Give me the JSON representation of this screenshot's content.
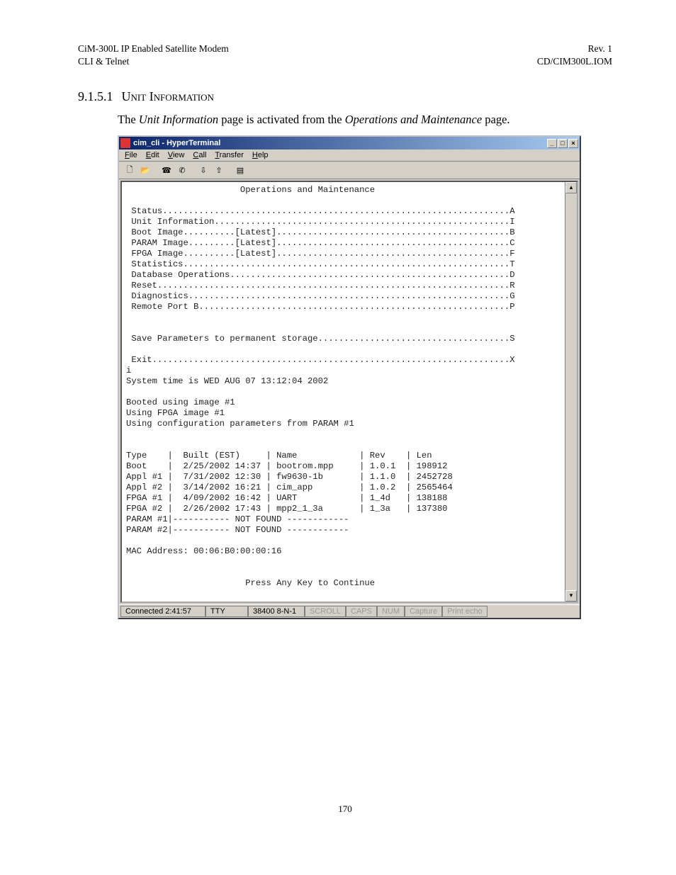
{
  "header": {
    "left1": "CiM-300L IP Enabled Satellite Modem",
    "left2": "CLI & Telnet",
    "right1": "Rev. 1",
    "right2": "CD/CIM300L.IOM"
  },
  "section": {
    "number": "9.1.5.1",
    "title_caps": "Unit Information",
    "intro_prefix": "The ",
    "intro_em1": "Unit Information",
    "intro_mid": " page is activated from the ",
    "intro_em2": "Operations and Maintenance",
    "intro_suffix": " page."
  },
  "win": {
    "title": "cim_cli - HyperTerminal",
    "menu": {
      "file": "File",
      "edit": "Edit",
      "view": "View",
      "call": "Call",
      "transfer": "Transfer",
      "help": "Help"
    },
    "controls": {
      "min": "_",
      "max": "□",
      "close": "×"
    },
    "toolbar_icons": [
      "new-doc-icon",
      "open-icon",
      "call-connect-icon",
      "call-disconnect-icon",
      "send-icon",
      "receive-icon",
      "properties-icon"
    ]
  },
  "term": {
    "heading": "                      Operations and Maintenance",
    "lines": [
      " Status...................................................................A",
      " Unit Information.........................................................I",
      " Boot Image..........[Latest].............................................B",
      " PARAM Image.........[Latest].............................................C",
      " FPGA Image..........[Latest].............................................F",
      " Statistics...............................................................T",
      " Database Operations......................................................D",
      " Reset....................................................................R",
      " Diagnostics..............................................................G",
      " Remote Port B............................................................P",
      "",
      "",
      " Save Parameters to permanent storage.....................................S",
      "",
      " Exit.....................................................................X",
      "i",
      "System time is WED AUG 07 13:12:04 2002",
      "",
      "Booted using image #1",
      "Using FPGA image #1",
      "Using configuration parameters from PARAM #1",
      "",
      "",
      "Type    |  Built (EST)     | Name            | Rev    | Len",
      "Boot    |  2/25/2002 14:37 | bootrom.mpp     | 1.0.1  | 198912",
      "Appl #1 |  7/31/2002 12:30 | fw9630-1b       | 1.1.0  | 2452728",
      "Appl #2 |  3/14/2002 16:21 | cim_app         | 1.0.2  | 2565464",
      "FPGA #1 |  4/09/2002 16:42 | UART            | 1_4d   | 138188",
      "FPGA #2 |  2/26/2002 17:43 | mpp2_1_3a       | 1_3a   | 137380",
      "PARAM #1|----------- NOT FOUND ------------",
      "PARAM #2|----------- NOT FOUND ------------",
      "",
      "MAC Address: 00:06:B0:00:00:16",
      "",
      "",
      "                       Press Any Key to Continue"
    ]
  },
  "statusbar": {
    "connected": "Connected 2:41:57",
    "emu": "TTY",
    "rate": "38400 8-N-1",
    "cells": [
      "SCROLL",
      "CAPS",
      "NUM",
      "Capture",
      "Print echo"
    ]
  },
  "page_number": "170"
}
